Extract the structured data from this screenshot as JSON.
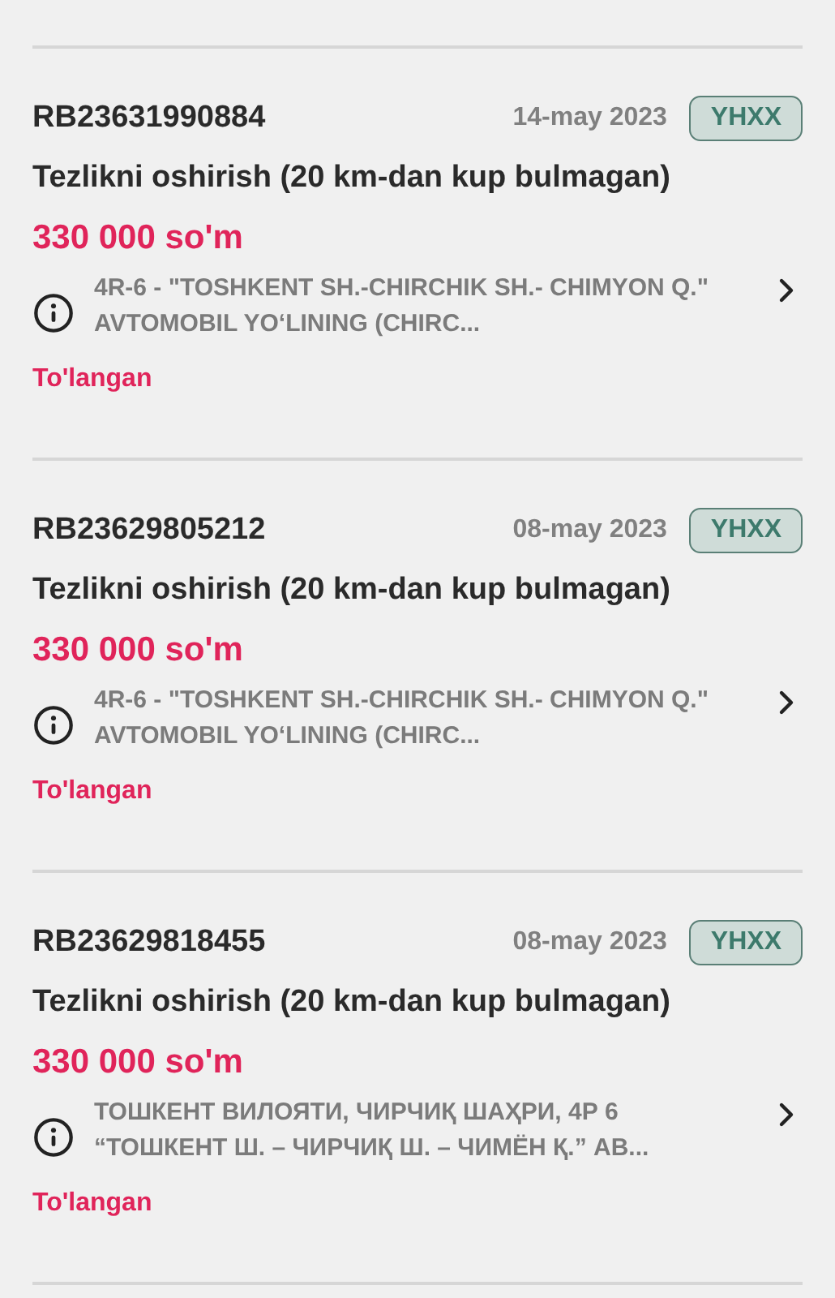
{
  "fines": [
    {
      "number": "RB23631990884",
      "date": "14-may 2023",
      "badge": "YHXX",
      "title": "Tezlikni oshirish (20 km-dan kup bulmagan)",
      "amount": "330 000 so'm",
      "address": "4R-6 - \"TOSHKENT SH.-CHIRCHIK SH.- CHIMYON Q.\" AVTOMOBIL YO‘LINING (CHIRC...",
      "status": "To'langan"
    },
    {
      "number": "RB23629805212",
      "date": "08-may 2023",
      "badge": "YHXX",
      "title": "Tezlikni oshirish (20 km-dan kup bulmagan)",
      "amount": "330 000 so'm",
      "address": "4R-6 - \"TOSHKENT SH.-CHIRCHIK SH.- CHIMYON Q.\" AVTOMOBIL YO‘LINING (CHIRC...",
      "status": "To'langan"
    },
    {
      "number": "RB23629818455",
      "date": "08-may 2023",
      "badge": "YHXX",
      "title": "Tezlikni oshirish (20 km-dan kup bulmagan)",
      "amount": "330 000 so'm",
      "address": "ТОШКЕНТ ВИЛОЯТИ, ЧИРЧИҚ ШАҲРИ, 4Р 6 “ТОШКЕНТ Ш. – ЧИРЧИҚ Ш. – ЧИМЁН Қ.” АВ...",
      "status": "To'langan"
    }
  ]
}
